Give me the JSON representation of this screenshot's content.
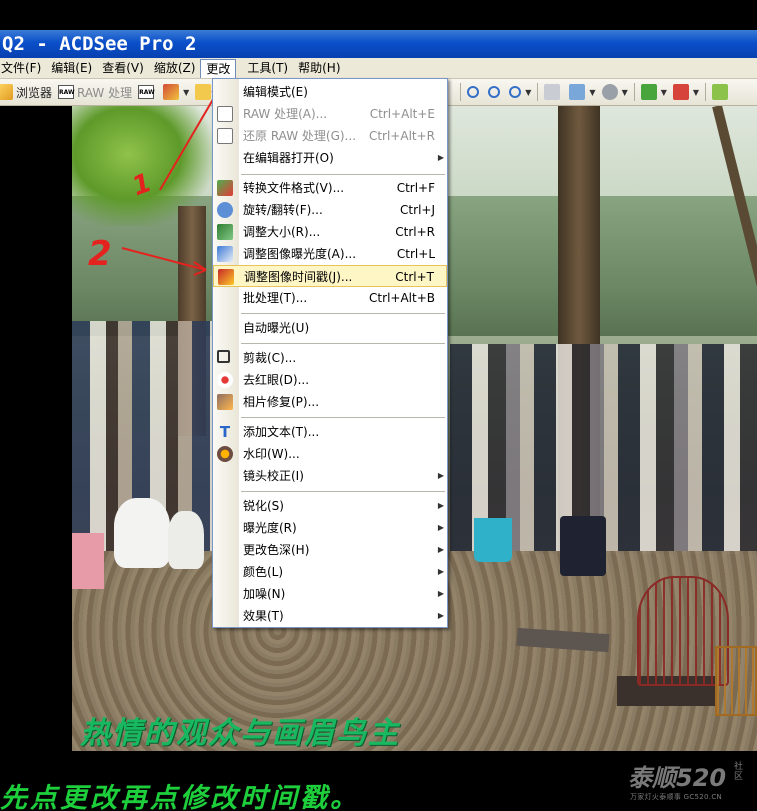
{
  "window": {
    "title": "Q2 - ACDSee Pro 2"
  },
  "menubar": [
    {
      "label": "文件(F)"
    },
    {
      "label": "编辑(E)"
    },
    {
      "label": "查看(V)"
    },
    {
      "label": "缩放(Z)"
    },
    {
      "label": "更改",
      "active": true
    },
    {
      "label": "工具(T)"
    },
    {
      "label": "帮助(H)"
    }
  ],
  "toolbar": {
    "browser_label": "浏览器",
    "raw_label": "RAW 处理"
  },
  "menu": {
    "items": [
      {
        "label": "编辑模式(E)",
        "shortcut": "",
        "icon": "none"
      },
      {
        "label": "RAW 处理(A)...",
        "shortcut": "Ctrl+Alt+E",
        "icon": "raw-icon",
        "disabled": true
      },
      {
        "label": "还原 RAW 处理(G)...",
        "shortcut": "Ctrl+Alt+R",
        "icon": "raw-icon",
        "disabled": true
      },
      {
        "label": "在编辑器打开(O)",
        "shortcut": "",
        "icon": "none",
        "submenu": true
      },
      {
        "label": "转换文件格式(V)...",
        "shortcut": "Ctrl+F",
        "icon": "convert-icon"
      },
      {
        "label": "旋转/翻转(F)...",
        "shortcut": "Ctrl+J",
        "icon": "rotate-icon"
      },
      {
        "label": "调整大小(R)...",
        "shortcut": "Ctrl+R",
        "icon": "resize-icon"
      },
      {
        "label": "调整图像曝光度(A)...",
        "shortcut": "Ctrl+L",
        "icon": "exposure-icon"
      },
      {
        "label": "调整图像时间戳(J)...",
        "shortcut": "Ctrl+T",
        "icon": "timestamp-icon",
        "highlight": true
      },
      {
        "label": "批处理(T)...",
        "shortcut": "Ctrl+Alt+B",
        "icon": "none"
      },
      {
        "label": "自动曝光(U)",
        "shortcut": "",
        "icon": "none"
      },
      {
        "label": "剪裁(C)...",
        "shortcut": "",
        "icon": "crop-icon"
      },
      {
        "label": "去红眼(D)...",
        "shortcut": "",
        "icon": "red-eye-icon"
      },
      {
        "label": "相片修复(P)...",
        "shortcut": "",
        "icon": "repair-icon"
      },
      {
        "label": "添加文本(T)...",
        "shortcut": "",
        "icon": "text-icon"
      },
      {
        "label": "水印(W)...",
        "shortcut": "",
        "icon": "watermark-icon"
      },
      {
        "label": "镜头校正(I)",
        "shortcut": "",
        "icon": "none",
        "submenu": true
      },
      {
        "label": "锐化(S)",
        "shortcut": "",
        "icon": "none",
        "submenu": true
      },
      {
        "label": "曝光度(R)",
        "shortcut": "",
        "icon": "none",
        "submenu": true
      },
      {
        "label": "更改色深(H)",
        "shortcut": "",
        "icon": "none",
        "submenu": true
      },
      {
        "label": "颜色(L)",
        "shortcut": "",
        "icon": "none",
        "submenu": true
      },
      {
        "label": "加噪(N)",
        "shortcut": "",
        "icon": "none",
        "submenu": true
      },
      {
        "label": "效果(T)",
        "shortcut": "",
        "icon": "none",
        "submenu": true
      }
    ]
  },
  "annotations": {
    "step1": "1",
    "step2": "2"
  },
  "captions": {
    "photo_caption": "热情的观众与画眉鸟主",
    "instruction": "先点更改再点修改时间戳。"
  },
  "watermark": {
    "main": "泰顺520",
    "tag": "社区",
    "sub": "万家灯火泰顺事 GC520.CN"
  },
  "colors": {
    "title_bar": "#0a4fc9",
    "menu_bg": "#ece9d8",
    "highlight_bg": "#fff6c6",
    "annotation_red": "#e4231e",
    "caption_green": "#1ecf3c"
  }
}
